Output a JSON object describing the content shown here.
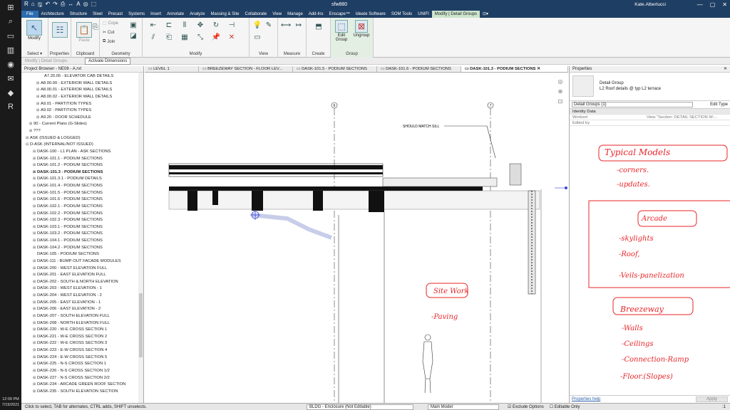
{
  "window": {
    "title": "sfw880",
    "user": "Kate.Albertucci",
    "winctl": [
      "—",
      "▢",
      "✕"
    ]
  },
  "taskbar": {
    "icons": [
      "⊞",
      "⌕",
      "▭",
      "▥",
      "◉",
      "✉",
      "◆",
      "R"
    ],
    "time": "12:09 PM",
    "date": "7/19/2021"
  },
  "quick_access": [
    "R",
    "⌂",
    "🖫",
    "↶",
    "↷",
    "⎙",
    "↔",
    "A",
    "◎",
    "⬚"
  ],
  "ribbon": {
    "tabs": [
      "File",
      "Architecture",
      "Structure",
      "Steel",
      "Precast",
      "Systems",
      "Insert",
      "Annotate",
      "Analyze",
      "Massing & Site",
      "Collaborate",
      "View",
      "Manage",
      "Add-Ins",
      "Enscape™",
      "Ideate Software",
      "SOM Tools",
      "UNIFI",
      "Modify | Detail Groups",
      "⊡▾"
    ],
    "panels": {
      "select": {
        "label": "Select ▾",
        "modify": "Modify"
      },
      "properties": {
        "label": "Properties"
      },
      "clipboard": {
        "label": "Clipboard",
        "paste": "Paste"
      },
      "geometry": {
        "label": "Geometry",
        "cope": "Cope",
        "cut": "Cut",
        "join": "Join"
      },
      "modify": {
        "label": "Modify"
      },
      "view": {
        "label": "View"
      },
      "measure": {
        "label": "Measure"
      },
      "create": {
        "label": "Create"
      },
      "group": {
        "label": "Group",
        "edit_group": "Edit Group",
        "ungroup": "Ungroup"
      }
    }
  },
  "options_bar": {
    "context": "Modify | Detail Groups",
    "activate_dimensions": "Activate Dimensions"
  },
  "project_browser": {
    "title": "Project Browser - NE08 - A.rvt",
    "items": [
      {
        "label": "A7.20.05 - ELEVATOR CAB DETAILS",
        "indent": 4,
        "expand": ""
      },
      {
        "label": "A8.00.00 - EXTERIOR WALL DETAILS",
        "indent": 3,
        "expand": "⊞"
      },
      {
        "label": "A8.00.01 - EXTERIOR WALL DETAILS",
        "indent": 3,
        "expand": "⊞"
      },
      {
        "label": "A8.00.02 - EXTERIOR WALL DETAILS",
        "indent": 3,
        "expand": "⊞"
      },
      {
        "label": "A9.01 - PARTITION TYPES",
        "indent": 3,
        "expand": "⊞"
      },
      {
        "label": "A9.02 - PARTITION TYPES",
        "indent": 3,
        "expand": "⊞"
      },
      {
        "label": "A9.20 - DOOR SCHEDULE",
        "indent": 3,
        "expand": "⊞"
      },
      {
        "label": "90 - Current Plans (G-Slides)",
        "indent": 1,
        "expand": "⊞"
      },
      {
        "label": "???",
        "indent": 1,
        "expand": "⊞"
      },
      {
        "label": "ASK (ISSUED & LOGGED)",
        "indent": 0,
        "expand": "⊞"
      },
      {
        "label": "D-ASK (INTERNAL/NOT ISSUED)",
        "indent": 0,
        "expand": "⊟"
      },
      {
        "label": "DASK-100 - L1 PLAN - ASK SECTIONS",
        "indent": 2,
        "expand": "⊞"
      },
      {
        "label": "DASK-101.1 - PODIUM SECTIONS",
        "indent": 2,
        "expand": "⊞"
      },
      {
        "label": "DASK-101.2 - PODIUM SECTIONS",
        "indent": 2,
        "expand": "⊞"
      },
      {
        "label": "DASK-101.3 - PODIUM SECTIONS",
        "indent": 2,
        "expand": "⊞",
        "selected": true
      },
      {
        "label": "DASK-101.3.1 - PODIUM DETAILS",
        "indent": 2,
        "expand": "⊞"
      },
      {
        "label": "DASK-101.4 - PODIUM SECTIONS",
        "indent": 2,
        "expand": "⊞"
      },
      {
        "label": "DASK-101.5 - PODIUM SECTIONS",
        "indent": 2,
        "expand": "⊞"
      },
      {
        "label": "DASK-101.6 - PODIUM SECTIONS",
        "indent": 2,
        "expand": "⊞"
      },
      {
        "label": "DASK-102.1 - PODIUM SECTIONS",
        "indent": 2,
        "expand": "⊞"
      },
      {
        "label": "DASK-102.2 - PODIUM SECTIONS",
        "indent": 2,
        "expand": "⊞"
      },
      {
        "label": "DASK-102.3 - PODIUM SECTIONS",
        "indent": 2,
        "expand": "⊞"
      },
      {
        "label": "DASK-103.1 - PODIUM SECTIONS",
        "indent": 2,
        "expand": "⊞"
      },
      {
        "label": "DASK-103.2 - PODIUM SECTIONS",
        "indent": 2,
        "expand": "⊞"
      },
      {
        "label": "DASK-104.1 - PODIUM SECTIONS",
        "indent": 2,
        "expand": "⊞"
      },
      {
        "label": "DASK-104.2 - PODIUM SECTIONS",
        "indent": 2,
        "expand": "⊞"
      },
      {
        "label": "DASK-105 - PODIUM SECTIONS",
        "indent": 2,
        "expand": ""
      },
      {
        "label": "DASK-111 - BUMP-OUT FACADE MODULES",
        "indent": 2,
        "expand": "⊞"
      },
      {
        "label": "DASK-200 - WEST ELEVATION FULL",
        "indent": 2,
        "expand": "⊞"
      },
      {
        "label": "DASK-201 - EAST ELEVATION FULL",
        "indent": 2,
        "expand": "⊞"
      },
      {
        "label": "DASK-202 - SOUTH & NORTH ELEVATION",
        "indent": 2,
        "expand": "⊞"
      },
      {
        "label": "DASK-203 - WEST ELEVATION - 1",
        "indent": 2,
        "expand": "⊞"
      },
      {
        "label": "DASK-204 - WEST ELEVATION - 2",
        "indent": 2,
        "expand": "⊞"
      },
      {
        "label": "DASK-205 - EAST ELEVATION - 1",
        "indent": 2,
        "expand": "⊞"
      },
      {
        "label": "DASK-206 - EAST ELEVATION - 2",
        "indent": 2,
        "expand": "⊞"
      },
      {
        "label": "DASK-207 - SOUTH ELEVATION FULL",
        "indent": 2,
        "expand": "⊞"
      },
      {
        "label": "DASK-208 - NORTH ELEVATION FULL",
        "indent": 2,
        "expand": "⊞"
      },
      {
        "label": "DASK-220 - W-E CROSS SECTION 1",
        "indent": 2,
        "expand": "⊞"
      },
      {
        "label": "DASK-221 - W-E CROSS SECTION 2",
        "indent": 2,
        "expand": "⊞"
      },
      {
        "label": "DASK-222 - W-E CROSS SECTION 3",
        "indent": 2,
        "expand": "⊞"
      },
      {
        "label": "DASK-223 - E-W CROSS SECTION 4",
        "indent": 2,
        "expand": "⊞"
      },
      {
        "label": "DASK-224 - E-W CROSS SECTION 5",
        "indent": 2,
        "expand": "⊞"
      },
      {
        "label": "DASK-225 - N-S CROSS SECTION 1",
        "indent": 2,
        "expand": "⊞"
      },
      {
        "label": "DASK-226 - N-S CROSS SECTION 1/2",
        "indent": 2,
        "expand": "⊞"
      },
      {
        "label": "DASK-227 - N-S CROSS SECTION 2/2",
        "indent": 2,
        "expand": "⊞"
      },
      {
        "label": "DASK-234 - ARCADE GREEN ROOF SECTION",
        "indent": 2,
        "expand": "⊞"
      },
      {
        "label": "DASK-235 - SOUTH ELEVATION SECTION",
        "indent": 2,
        "expand": "⊞"
      }
    ]
  },
  "view_tabs": [
    {
      "label": "LEVEL 1",
      "icon": "▭"
    },
    {
      "label": "BREEZEWAY SECTION - FLOOR LEV...",
      "icon": "▭"
    },
    {
      "label": "DASK-101.5 - PODIUM SECTIONS",
      "icon": "▭"
    },
    {
      "label": "DASK-101.6 - PODIUM SECTIONS",
      "icon": "▭"
    },
    {
      "label": "DASK-101.3 - PODIUM SECTIONS ✕",
      "icon": "▭",
      "active": true
    }
  ],
  "canvas": {
    "grid_labels": [
      "6",
      "7"
    ],
    "note": "SHOULD MATCH SILL",
    "nav_icons": [
      "◎",
      "⊕",
      "⊡"
    ]
  },
  "properties": {
    "title": "Properties",
    "close": "✕",
    "type_name": "Detail Group",
    "type_value": "L2 Roof details @ typ L2 terrace",
    "selector": "Detail Groups (1)",
    "edit_type": "Edit Type",
    "group_header": "Identity Data",
    "rows": [
      {
        "key": "Workset",
        "value": "View \"Section: DETAIL SECTION W-..."
      },
      {
        "key": "Edited by",
        "value": ""
      }
    ],
    "help": "Properties help",
    "apply": "Apply"
  },
  "handwriting": {
    "color": "#e8262a",
    "lines": [
      "Typical Models",
      "-corners.",
      "-updates.",
      "Arcade",
      "-skylights",
      "-Roof,",
      "-Veils-panelization",
      "Breezeway",
      "-Walls",
      "-Ceilings",
      "-Connection-Ramp",
      "-Floor.(Slopes)",
      "Site Work",
      "-Paving"
    ]
  },
  "status_bar": {
    "hint": "Click to select, TAB for alternates, CTRL adds, SHIFT unselects.",
    "workset": "BLDG - Enclosure (Not Editable)",
    "design_option": "Main Model",
    "exclude_options": "Exclude Options",
    "editable_only": "Editable Only",
    "filter_count": ":1"
  }
}
